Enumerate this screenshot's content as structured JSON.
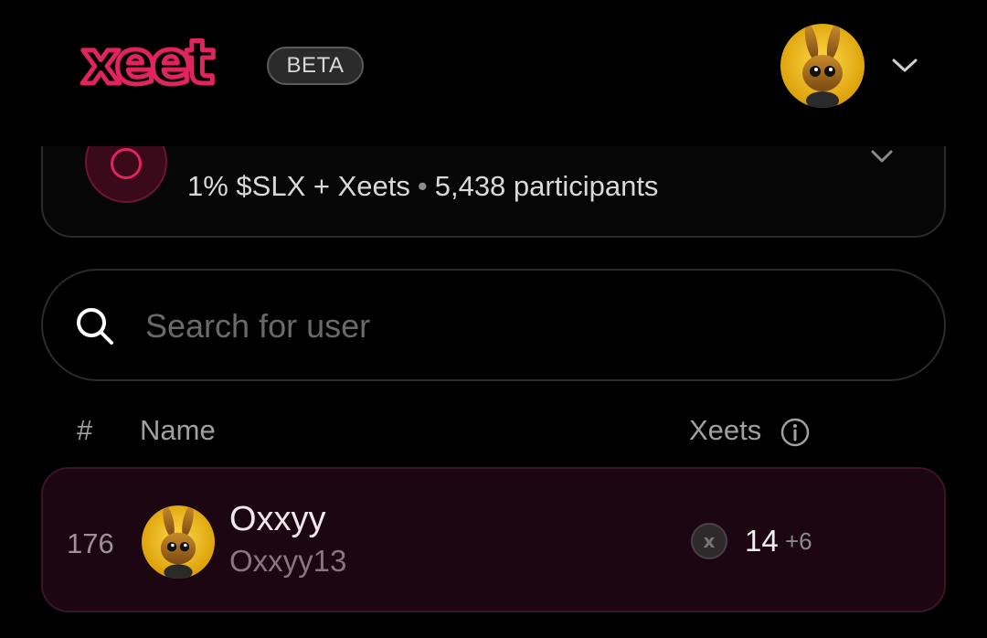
{
  "header": {
    "logo_text": "xeet",
    "beta_label": "BETA",
    "brand_color": "#e0245e",
    "avatar_icon": "golden-rabbit-avatar",
    "menu_icon": "chevron-down-icon"
  },
  "campaign": {
    "reward": "1% $SLX + Xeets",
    "separator": "•",
    "participants": "5,438 participants",
    "icon": "power-icon",
    "toggle_icon": "chevron-down-icon"
  },
  "search": {
    "placeholder": "Search for user",
    "value": "",
    "icon": "search-icon"
  },
  "table": {
    "headers": {
      "rank": "#",
      "name": "Name",
      "xeets": "Xeets"
    },
    "info_icon": "info-icon",
    "rows": [
      {
        "rank": "176",
        "name": "Oxxyy",
        "handle": "Oxxyy13",
        "xeets": "14",
        "delta": "+6",
        "avatar_icon": "golden-rabbit-avatar",
        "xeet_icon": "xeet-token-icon"
      }
    ]
  }
}
